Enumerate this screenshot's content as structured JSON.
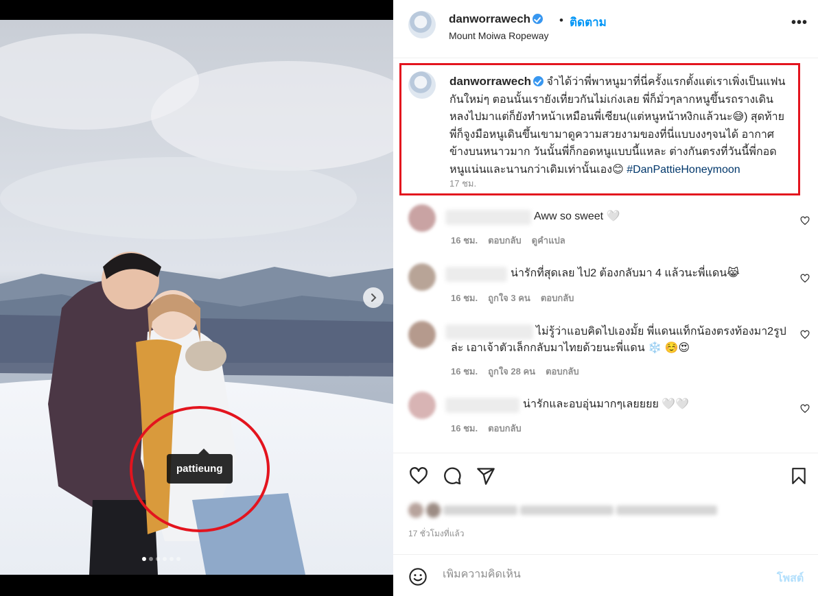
{
  "media": {
    "tag_username": "pattieung",
    "carousel_count": 6,
    "carousel_active": 1
  },
  "header": {
    "username": "danworrawech",
    "separator": "•",
    "follow_label": "ติดตาม",
    "location": "Mount Moiwa Ropeway",
    "more_icon": "more-horizontal-icon"
  },
  "caption": {
    "username": "danworrawech",
    "text": "จำได้ว่าพี่พาหนูมาที่นี่ครั้งแรกตั้งแต่เราเพิ่งเป็นแฟนกันใหม่ๆ ตอนนั้นเรายังเที่ยวกันไม่เก่งเลย พี่ก็มั่วๆลากหนูขึ้นรถรางเดินหลงไปมาแต่ก็ยังทำหน้าเหมือนพี่เซียน(แต่หนูหน้าหงิกแล้วนะ😅) สุดท้ายพี่ก็จูงมือหนูเดินขึ้นเขามาดูความสวยงามของที่นี่แบบงงๆจนได้ อากาศข้างบนหนาวมาก วันนั้นพี่ก็กอดหนูแบบนี้แหละ ต่างกันตรงที่วันนี้พี่กอดหนูแน่นและนานกว่าเดิมเท่านั้นเอง😊 ",
    "hashtag": "#DanPattieHoneymoon",
    "time": "17 ชม."
  },
  "comments": [
    {
      "text": "Aww so sweet 🤍",
      "time": "16 ชม.",
      "reply_label": "ตอบกลับ",
      "likes": "",
      "translate_label": "ดูคำแปล"
    },
    {
      "text": "น่ารักที่สุดเลย ไป2 ต้องกลับมา 4 แล้วนะพี่แดน😹",
      "time": "16 ชม.",
      "likes": "ถูกใจ 3 คน",
      "reply_label": "ตอบกลับ"
    },
    {
      "text": "ไม่รู้ว่าแอบคิดไปเองมั้ย พี่แดนแท็กน้องตรงท้องมา2รูปล่ะ เอาเจ้าตัวเล็กกลับมาไทยด้วยนะพี่แดน ❄️ ☺️😍",
      "time": "16 ชม.",
      "likes": "ถูกใจ 28 คน",
      "reply_label": "ตอบกลับ"
    },
    {
      "text": "น่ารักและอบอุ่นมากๆเลยยยย 🤍🤍",
      "time": "16 ชม.",
      "reply_label": "ตอบกลับ"
    }
  ],
  "actions": {
    "like_icon": "heart-icon",
    "comment_icon": "comment-icon",
    "share_icon": "share-icon",
    "save_icon": "bookmark-icon",
    "posted_ago": "17 ชั่วโมงที่แล้ว"
  },
  "add_comment": {
    "placeholder": "เพิ่มความคิดเห็น",
    "post_label": "โพสต์"
  },
  "colors": {
    "accent": "#0095f6",
    "highlight_red": "#e3141e",
    "muted": "#8e8e8e"
  }
}
